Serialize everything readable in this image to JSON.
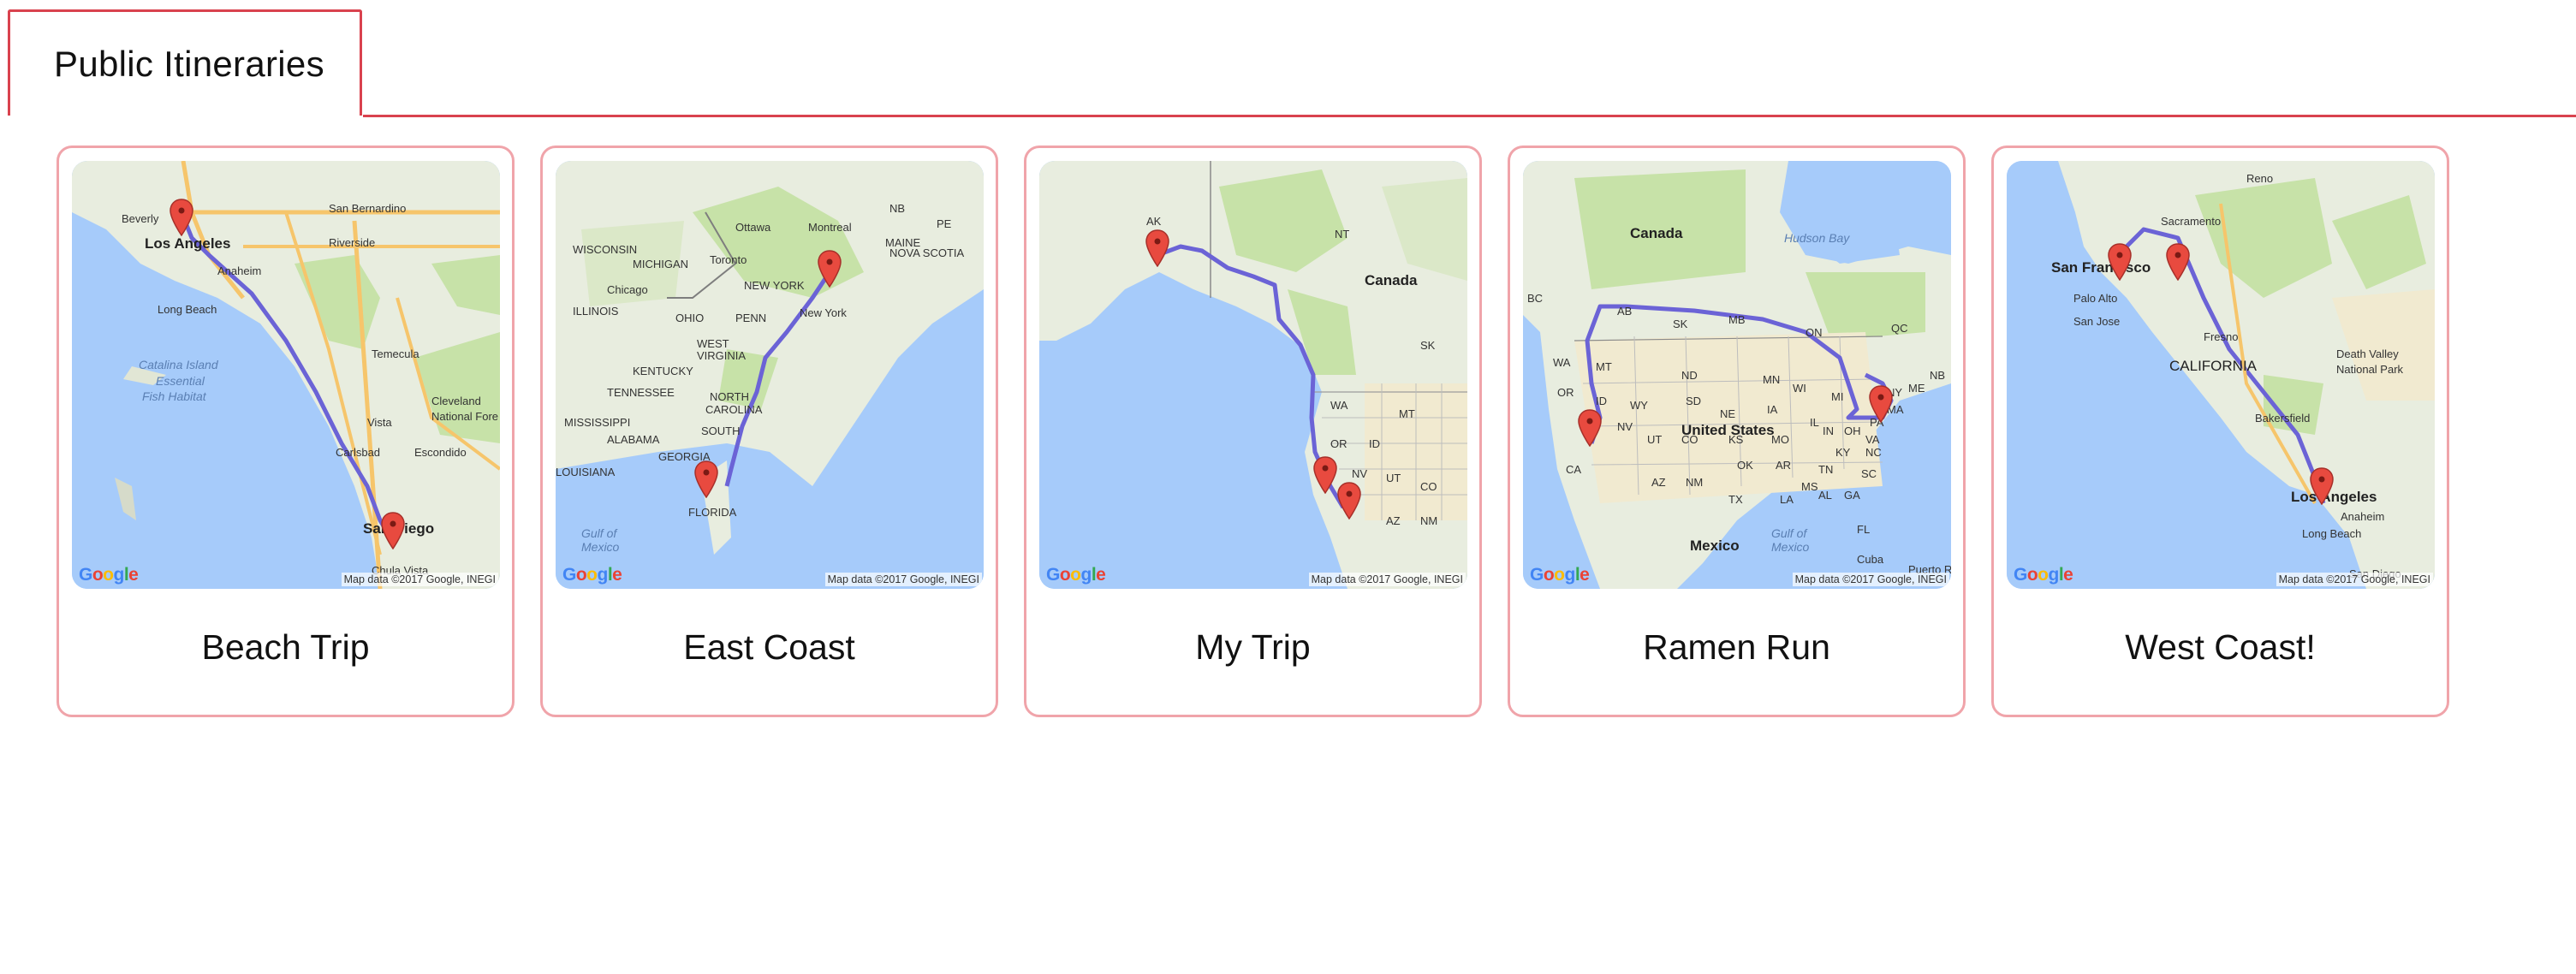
{
  "tab": {
    "label": "Public Itineraries"
  },
  "map_common": {
    "google_logo": "Google",
    "credit": "Map data ©2017 Google, INEGI"
  },
  "cards": [
    {
      "title": "Beach Trip",
      "places": [
        "Beverly",
        "Los Angeles",
        "San Bernardino",
        "Riverside",
        "Anaheim",
        "Long Beach",
        "Temecula",
        "Catalina Island Essential Fish Habitat",
        "Vista",
        "Carlsbad",
        "Escondido",
        "Cleveland National Forest",
        "San Diego",
        "Chula Vista"
      ]
    },
    {
      "title": "East Coast",
      "places": [
        "Ottawa",
        "Montreal",
        "WISCONSIN",
        "MICHIGAN",
        "Toronto",
        "MAINE",
        "NB",
        "PE",
        "NOVA SCOTIA",
        "NEW YORK",
        "Chicago",
        "ILLINOIS",
        "OHIO",
        "PENN",
        "New York",
        "WEST VIRGINIA",
        "VIRGINIA",
        "KENTUCKY",
        "TENNESSEE",
        "NORTH CAROLINA",
        "SOUTH CAROLINA",
        "MISSISSIPPI",
        "ALABAMA",
        "GEORGIA",
        "LOUISIANA",
        "FLORIDA",
        "Gulf of Mexico"
      ]
    },
    {
      "title": "My Trip",
      "places": [
        "AK",
        "NT",
        "Canada",
        "SK",
        "WA",
        "MT",
        "OR",
        "ID",
        "NV",
        "UT",
        "CO",
        "AZ",
        "NM"
      ]
    },
    {
      "title": "Ramen Run",
      "places": [
        "Canada",
        "Hudson Bay",
        "BC",
        "AB",
        "SK",
        "MB",
        "ON",
        "QC",
        "NB",
        "ME",
        "MA",
        "WA",
        "OR",
        "CA",
        "NV",
        "ID",
        "MT",
        "WY",
        "UT",
        "CO",
        "AZ",
        "NM",
        "ND",
        "SD",
        "NE",
        "KS",
        "OK",
        "TX",
        "MN",
        "IA",
        "MO",
        "AR",
        "LA",
        "WI",
        "IL",
        "MI",
        "IN",
        "OH",
        "KY",
        "TN",
        "MS",
        "AL",
        "GA",
        "FL",
        "SC",
        "NC",
        "VA",
        "PA",
        "NY",
        "United States",
        "Mexico",
        "Gulf of Mexico",
        "Cuba",
        "Puerto Rico"
      ]
    },
    {
      "title": "West Coast!",
      "places": [
        "Reno",
        "Sacramento",
        "San Francisco",
        "Palo Alto",
        "San Jose",
        "Fresno",
        "CALIFORNIA",
        "Death Valley National Park",
        "Bakersfield",
        "Los Angeles",
        "Anaheim",
        "Long Beach",
        "San Diego"
      ]
    }
  ],
  "colors": {
    "tab_border": "#d9424e",
    "card_border": "#f0a4aa",
    "route": "#6b63d6",
    "marker": "#e84a3f",
    "water": "#a6cbfa",
    "land": "#e8eddf",
    "forest": "#c7e2a8"
  }
}
